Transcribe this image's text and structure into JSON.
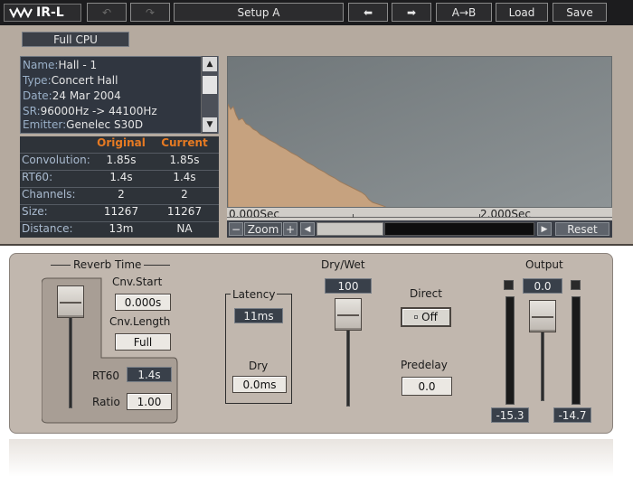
{
  "toolbar": {
    "logo": "IR-L",
    "undo": "↶",
    "redo": "↷",
    "setup": "Setup A",
    "prev": "⬅",
    "next": "➡",
    "ab": "A→B",
    "load": "Load",
    "save": "Save"
  },
  "cpu_mode": "Full CPU",
  "info": {
    "name_label": "Name:",
    "name": "Hall - 1",
    "type_label": "Type:",
    "type": "Concert Hall",
    "date_label": "Date:",
    "date": "24 Mar 2004",
    "sr_label": "SR:",
    "sr": "96000Hz -> 44100Hz",
    "emitter_label": "Emitter:",
    "emitter": "Genelec S30D"
  },
  "table": {
    "col_original": "Original",
    "col_current": "Current",
    "rows": [
      {
        "label": "Convolution:",
        "original": "1.85s",
        "current": "1.85s"
      },
      {
        "label": "RT60:",
        "original": "1.4s",
        "current": "1.4s"
      },
      {
        "label": "Channels:",
        "original": "2",
        "current": "2"
      },
      {
        "label": "Size:",
        "original": "11267",
        "current": "11267"
      },
      {
        "label": "Distance:",
        "original": "13m",
        "current": "NA"
      }
    ]
  },
  "graph": {
    "tick_start": "0.000Sec",
    "tick_end": "2.000Sec",
    "zoom_minus": "−",
    "zoom_label": "Zoom",
    "zoom_plus": "+",
    "reset": "Reset",
    "colors": {
      "bg": "#7d8384",
      "fill": "#c6a27f"
    }
  },
  "reverb_time": {
    "title": "Reverb Time",
    "cnv_start_label": "Cnv.Start",
    "cnv_start": "0.000s",
    "cnv_length_label": "Cnv.Length",
    "cnv_length": "Full",
    "rt60_label": "RT60",
    "rt60": "1.4s",
    "ratio_label": "Ratio",
    "ratio": "1.00"
  },
  "latency": {
    "title": "Latency",
    "value": "11ms",
    "dry_label": "Dry",
    "dry": "0.0ms"
  },
  "dry_wet": {
    "title": "Dry/Wet",
    "value": "100"
  },
  "direct": {
    "title": "Direct",
    "value": "Off"
  },
  "predelay": {
    "title": "Predelay",
    "value": "0.0"
  },
  "output": {
    "title": "Output",
    "value": "0.0",
    "left_peak": "-15.3",
    "right_peak": "-14.7"
  }
}
